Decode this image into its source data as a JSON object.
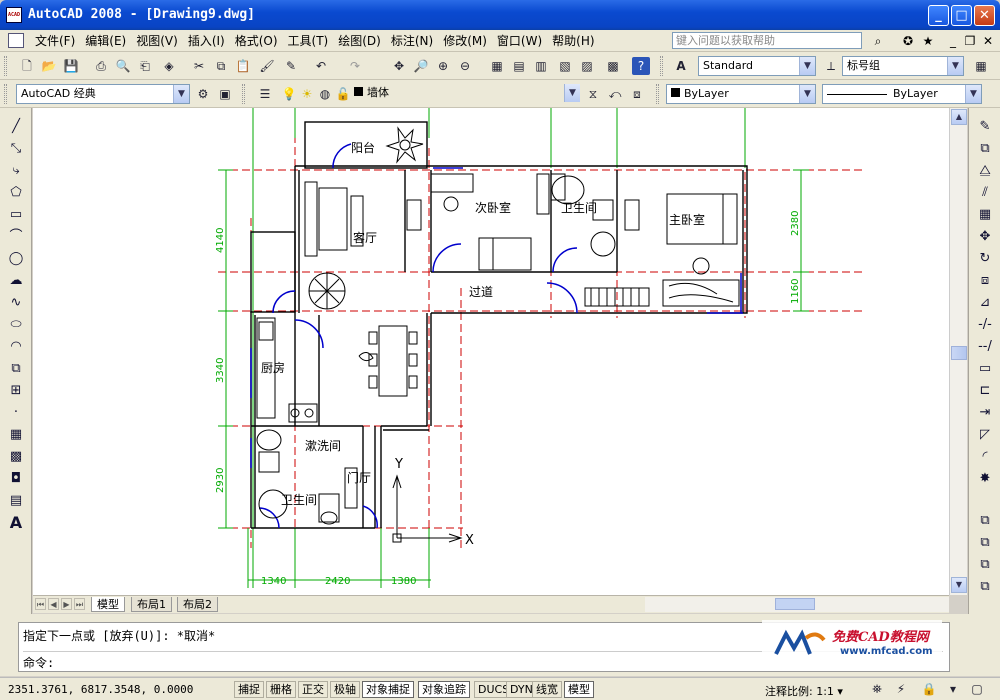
{
  "window": {
    "title": "AutoCAD 2008 - [Drawing9.dwg]",
    "app_icon_text": "ACAD",
    "controls": [
      "minimize",
      "maximize",
      "close"
    ]
  },
  "menubar": {
    "items": [
      "文件(F)",
      "编辑(E)",
      "视图(V)",
      "插入(I)",
      "格式(O)",
      "工具(T)",
      "绘图(D)",
      "标注(N)",
      "修改(M)",
      "窗口(W)",
      "帮助(H)"
    ],
    "help_search_placeholder": "键入问题以获取帮助",
    "right_controls": [
      "search-icon",
      "communication-icon",
      "star-icon",
      "doc-minimize",
      "doc-restore",
      "doc-close"
    ]
  },
  "toolbar1": {
    "text_style": "Standard",
    "dim_style": "标号组"
  },
  "toolbar2": {
    "workspace": "AutoCAD 经典",
    "layer": "墙体",
    "color": "ByLayer",
    "linetype": "ByLayer"
  },
  "drawing": {
    "rooms": {
      "balcony": "阳台",
      "living": "客厅",
      "second_bedroom": "次卧室",
      "bath1": "卫生间",
      "master_bedroom": "主卧室",
      "hallway": "过道",
      "kitchen": "厨房",
      "laundry": "漱洗间",
      "foyer": "门厅",
      "bath2": "卫生间"
    },
    "dimensions": {
      "left": [
        "4140",
        "3340",
        "2930"
      ],
      "right": [
        "2380",
        "1160"
      ],
      "bottom": [
        "1340",
        "2420",
        "1380"
      ]
    },
    "ucs": {
      "x": "X",
      "y": "Y"
    }
  },
  "layout_tabs": {
    "tabs": [
      "模型",
      "布局1",
      "布局2"
    ],
    "active": "模型"
  },
  "command": {
    "history": "指定下一点或 [放弃(U)]: *取消*",
    "prompt": "命令:"
  },
  "watermark": {
    "title": "免费CAD教程网",
    "url": "www.mfcad.com"
  },
  "statusbar": {
    "coords": "2351.3761, 6817.3548, 0.0000",
    "buttons": [
      "捕捉",
      "栅格",
      "正交",
      "极轴",
      "对象捕捉",
      "对象追踪",
      "DUCS",
      "DYN",
      "线宽",
      "模型"
    ],
    "annotation_scale_label": "注释比例:",
    "annotation_scale": "1:1"
  },
  "colors": {
    "titlebar": "#0a4ad0",
    "wall": "#000000",
    "axis_line": "#cc0000",
    "dimension": "#00aa00",
    "door": "#0000cc"
  }
}
